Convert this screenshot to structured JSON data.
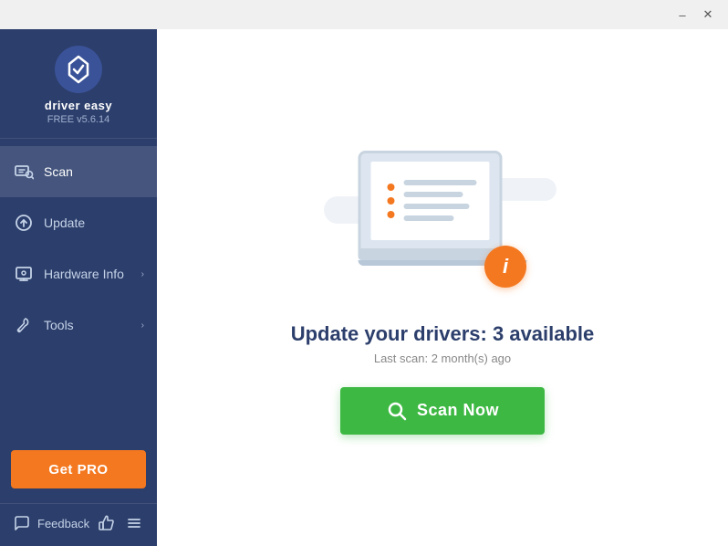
{
  "titlebar": {
    "minimize_label": "–",
    "close_label": "✕"
  },
  "sidebar": {
    "logo": {
      "app_name": "driver easy",
      "version": "FREE v5.6.14"
    },
    "nav_items": [
      {
        "id": "scan",
        "label": "Scan",
        "active": true,
        "has_chevron": false
      },
      {
        "id": "update",
        "label": "Update",
        "active": false,
        "has_chevron": false
      },
      {
        "id": "hardware-info",
        "label": "Hardware Info",
        "active": false,
        "has_chevron": true
      },
      {
        "id": "tools",
        "label": "Tools",
        "active": false,
        "has_chevron": true
      }
    ],
    "get_pro_label": "Get PRO",
    "feedback_label": "Feedback"
  },
  "main": {
    "headline": "Update your drivers: 3 available",
    "subtext": "Last scan: 2 month(s) ago",
    "scan_button_label": "Scan Now"
  }
}
